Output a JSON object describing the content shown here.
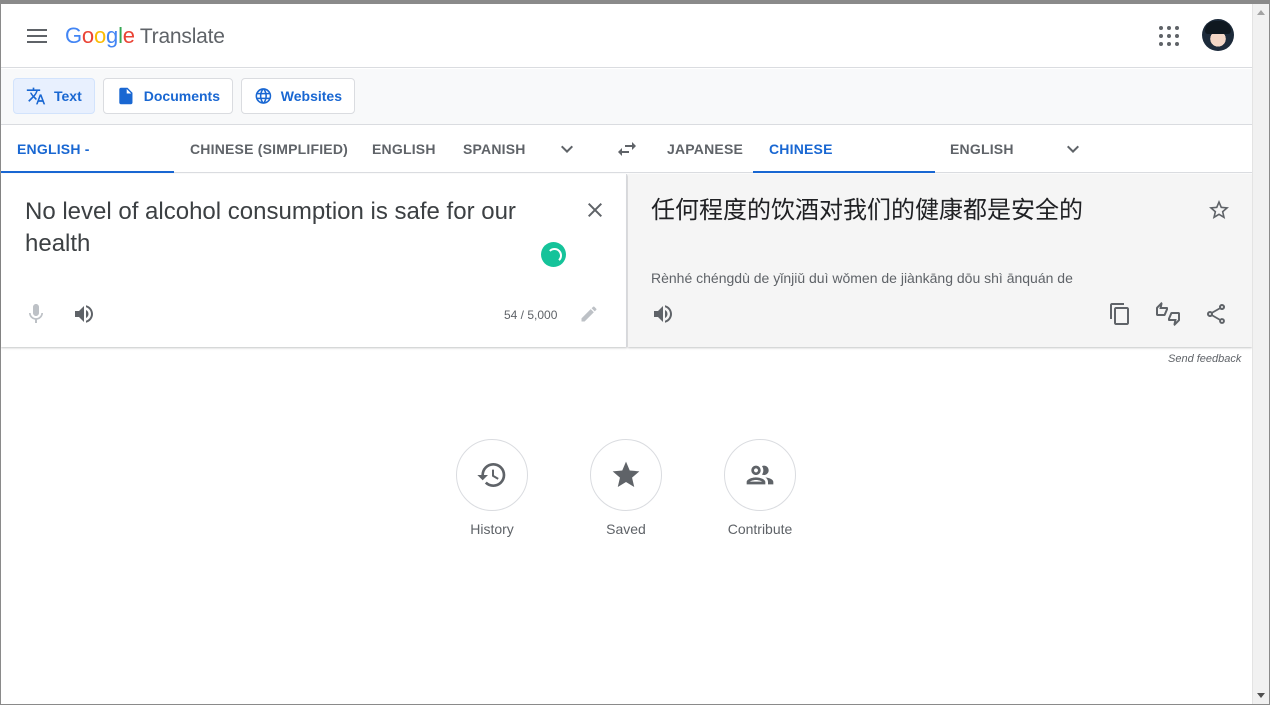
{
  "header": {
    "logo_letters": [
      "G",
      "o",
      "o",
      "g",
      "l",
      "e"
    ],
    "product": "Translate"
  },
  "modes": [
    {
      "label": "Text",
      "icon": "translate-icon",
      "active": true
    },
    {
      "label": "Documents",
      "icon": "document-icon",
      "active": false
    },
    {
      "label": "Websites",
      "icon": "globe-icon",
      "active": false
    }
  ],
  "source_languages": [
    {
      "label": "ENGLISH - DETECTED",
      "active": true
    },
    {
      "label": "CHINESE (SIMPLIFIED)",
      "active": false
    },
    {
      "label": "ENGLISH",
      "active": false
    },
    {
      "label": "SPANISH",
      "active": false
    }
  ],
  "target_languages": [
    {
      "label": "JAPANESE",
      "active": false
    },
    {
      "label": "CHINESE (SIMPLIFIED)",
      "active": true
    },
    {
      "label": "ENGLISH",
      "active": false
    }
  ],
  "source": {
    "text": "No level of alcohol consumption is safe for our health",
    "char_count": "54 / 5,000"
  },
  "target": {
    "text": "任何程度的饮酒对我们的健康都是安全的",
    "romanization": "Rènhé chéngdù de yǐnjiǔ duì wǒmen de jiànkāng dōu shì ānquán de"
  },
  "feedback_label": "Send feedback",
  "bottom_actions": [
    {
      "label": "History",
      "icon": "history-icon"
    },
    {
      "label": "Saved",
      "icon": "star-icon"
    },
    {
      "label": "Contribute",
      "icon": "people-icon"
    }
  ],
  "colors": {
    "accent": "#1967d2",
    "grammarly": "#15c39a",
    "target_bg": "#f5f5f5"
  }
}
